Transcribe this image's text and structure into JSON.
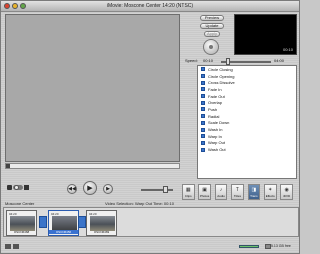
{
  "window": {
    "title": "iMovie: Moscone Center  14:20 (NTSC)"
  },
  "preview_panel": {
    "preview_label": "Preview",
    "update_label": "Update",
    "apply_label": "Apply",
    "preview_timecode": "00:10",
    "speed_label": "Speed:",
    "speed_min": "00:10",
    "speed_max": "04:00"
  },
  "transitions": [
    "Circle Closing",
    "Circle Opening",
    "Cross Dissolve",
    "Fade In",
    "Fade Out",
    "Overlap",
    "Push",
    "Radial",
    "Scale Down",
    "Wash In",
    "Warp In",
    "Warp Out",
    "Wash Out"
  ],
  "tabs": [
    {
      "label": "Clips",
      "icon": "clips-icon"
    },
    {
      "label": "Photos",
      "icon": "photos-icon"
    },
    {
      "label": "Audio",
      "icon": "audio-icon"
    },
    {
      "label": "Titles",
      "icon": "titles-icon"
    },
    {
      "label": "Trans",
      "icon": "transitions-icon"
    },
    {
      "label": "Effects",
      "icon": "effects-icon"
    },
    {
      "label": "iDVD",
      "icon": "idvd-icon"
    }
  ],
  "active_tab": "Trans",
  "timeline": {
    "project_label": "Moscone Center",
    "selection_label": "Video Selection: Warp Out  Time: 00:10",
    "clips": [
      {
        "duration": "04:20",
        "name": "OSCN6468"
      },
      {
        "duration": "04:20",
        "name": "OSCN6456"
      },
      {
        "duration": "04:20",
        "name": "OSCN6469"
      }
    ]
  },
  "status": {
    "free_space": "5.13 GB free"
  },
  "colors": {
    "accent": "#3b74c9",
    "disk_meter": "#6ac16a"
  }
}
